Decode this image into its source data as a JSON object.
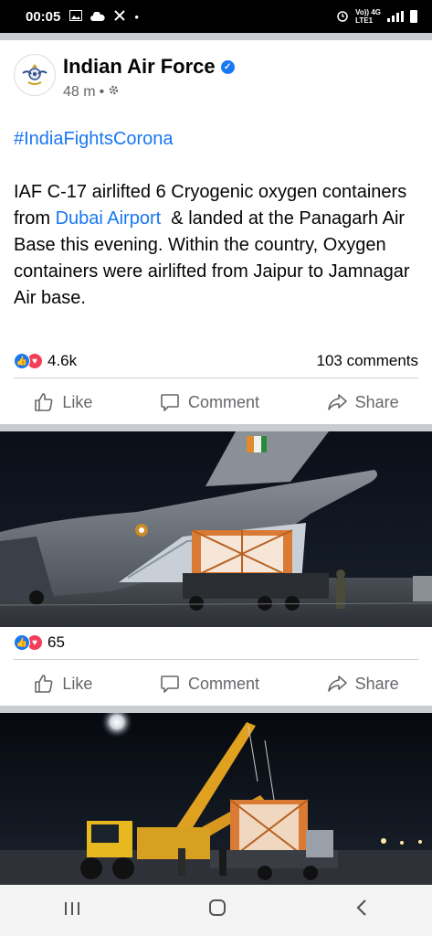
{
  "status_bar": {
    "time": "00:05",
    "net_top": "Vo)) 4G",
    "net_bottom": "LTE1"
  },
  "post": {
    "page_name": "Indian Air Force",
    "time_ago": "48 m",
    "hashtag": "#IndiaFightsCorona",
    "text_part1": "IAF C-17 airlifted 6 Cryogenic oxygen containers from ",
    "link_text": "Dubai Airport",
    "text_part2": "  & landed at the Panagarh Air Base this evening. Within the country, Oxygen containers were airlifted from Jaipur to Jamnagar Air base.",
    "reaction_count": "4.6k",
    "comment_count": "103 comments"
  },
  "actions": {
    "like": "Like",
    "comment": "Comment",
    "share": "Share"
  },
  "photo1": {
    "reaction_count": "65"
  },
  "colors": {
    "link": "#1877f2",
    "love": "#f33e58",
    "separator": "#c9ccd1"
  },
  "icons": [
    "photo-icon",
    "cloud-icon",
    "tools-icon",
    "alarm-icon",
    "signal-icon",
    "battery-icon",
    "verified-icon",
    "settings-icon",
    "like-icon",
    "comment-icon",
    "share-icon",
    "recent-apps-icon",
    "home-icon",
    "back-icon"
  ]
}
